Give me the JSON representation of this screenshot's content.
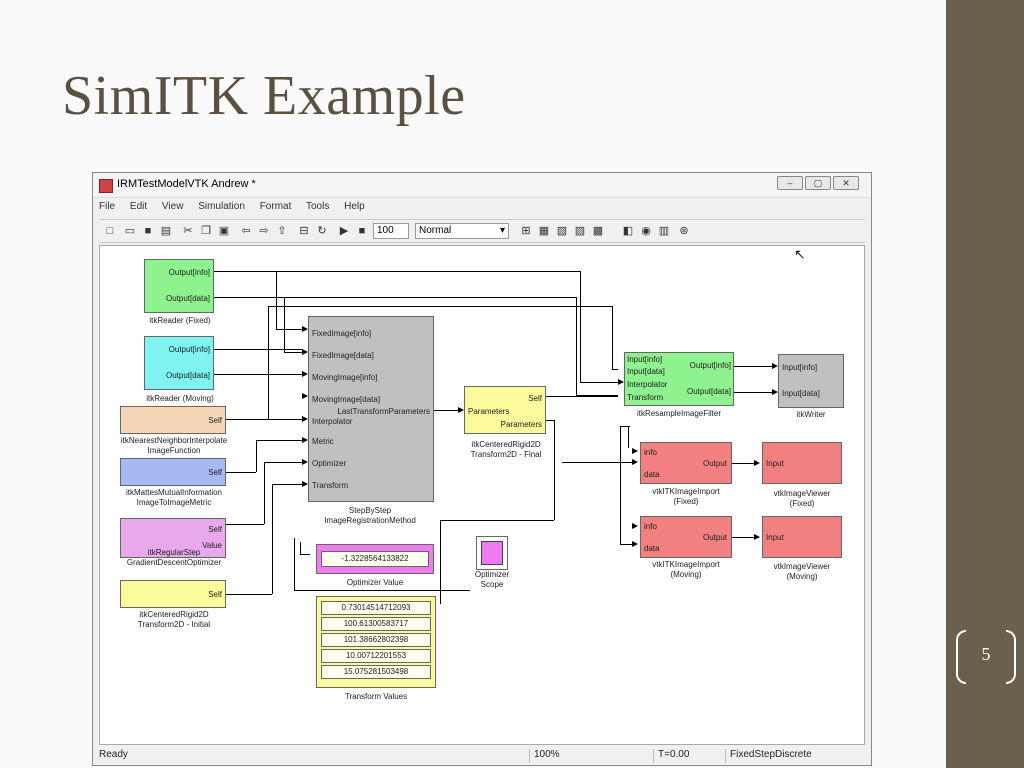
{
  "slide": {
    "title": "SimITK Example",
    "page_number": "5"
  },
  "window": {
    "title": "IRMTestModelVTK Andrew *",
    "controls": [
      "–",
      "▢",
      "✕"
    ]
  },
  "menu": [
    "File",
    "Edit",
    "View",
    "Simulation",
    "Format",
    "Tools",
    "Help"
  ],
  "toolbar": {
    "stop_time": "100",
    "mode": "Normal"
  },
  "blocks": {
    "reader_fixed": {
      "ports": [
        "Output[info]",
        "Output[data]"
      ],
      "caption": "itkReader (Fixed)",
      "color": "#8ef28e"
    },
    "reader_moving": {
      "ports": [
        "Output[info]",
        "Output[data]"
      ],
      "caption": "itkReader (Moving)",
      "color": "#7ff2f2"
    },
    "interpolator": {
      "port": "Self",
      "caption_1": "itkNearestNeighborInterpolate",
      "caption_2": "ImageFunction",
      "color": "#f7d6b8"
    },
    "metric": {
      "port": "Self",
      "caption_1": "itkMattesMutualInformation",
      "caption_2": "ImageToImageMetric",
      "color": "#a8b8f2"
    },
    "optimizer": {
      "ports": [
        "Self",
        "Value"
      ],
      "caption_1": "itkRegularStep",
      "caption_2": "GradientDescentOptimizer",
      "color": "#e8a8ec"
    },
    "initial_transform": {
      "port": "Self",
      "caption_1": "itkCenteredRigid2D",
      "caption_2": "Transform2D - Initial",
      "color": "#fbfb9b"
    },
    "registration": {
      "ports_in": [
        "FixedImage[info]",
        "FixedImage[data]",
        "MovingImage[info]",
        "MovingImage[data]",
        "Interpolator",
        "Metric",
        "Optimizer",
        "Transform"
      ],
      "port_out": "LastTransformParameters",
      "caption_1": "StepByStep",
      "caption_2": "ImageRegistrationMethod",
      "color": "#c0c0c0"
    },
    "final_transform": {
      "ports": [
        "Self",
        "Parameters",
        "Parameters"
      ],
      "caption_1": "itkCenteredRigid2D",
      "caption_2": "Transform2D - Final",
      "color": "#fbfb9b"
    },
    "resample": {
      "ports_in": [
        "Input[info]",
        "Input[data]",
        "Interpolator",
        "Transform"
      ],
      "ports_out": [
        "Output[info]",
        "Output[data]"
      ],
      "caption": "itkResampleImageFilter",
      "color": "#8ef28e"
    },
    "writer": {
      "ports": [
        "Input[info]",
        "Input[data]"
      ],
      "caption": "itkWriter",
      "color": "#c0c0c0"
    },
    "import_fixed": {
      "ports": [
        "info",
        "data",
        "Output"
      ],
      "caption_1": "vtkITKImageImport",
      "caption_2": "(Fixed)",
      "color": "#f28080"
    },
    "viewer_fixed": {
      "port": "Input",
      "caption_1": "vtkImageViewer",
      "caption_2": "(Fixed)",
      "color": "#f28080"
    },
    "import_moving": {
      "ports": [
        "info",
        "data",
        "Output"
      ],
      "caption_1": "vtkITKImageImport",
      "caption_2": "(Moving)",
      "color": "#f28080"
    },
    "viewer_moving": {
      "port": "Input",
      "caption_1": "vtkImageViewer",
      "caption_2": "(Moving)",
      "color": "#f28080"
    },
    "optimizer_value": {
      "value": "-1.3228564133822",
      "caption": "Optimizer Value",
      "color": "#f07af0"
    },
    "optimizer_scope": {
      "caption_1": "Optimizer",
      "caption_2": "Scope",
      "color": "#f07af0"
    },
    "transform_values": {
      "values": [
        "0.73014514712093",
        "100.61300583717",
        "101.38662802398",
        "10.00712201553",
        "15.075281503498"
      ],
      "caption": "Transform Values",
      "color": "#fbfb9b"
    }
  },
  "status": {
    "state": "Ready",
    "zoom": "100%",
    "time": "T=0.00",
    "solver": "FixedStepDiscrete"
  }
}
